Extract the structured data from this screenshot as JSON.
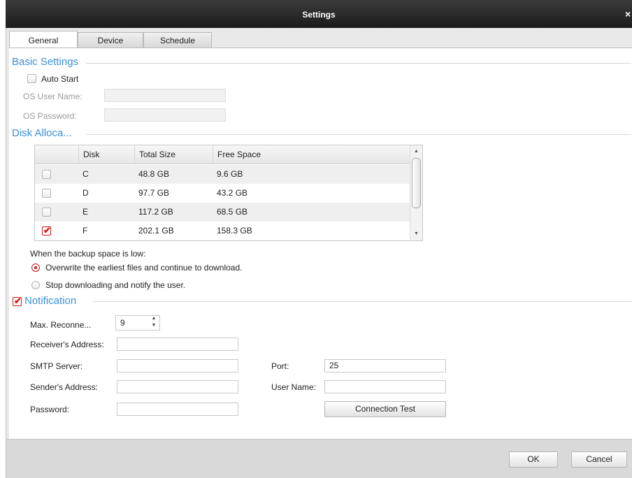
{
  "window": {
    "title": "Settings",
    "close_glyph": "×"
  },
  "tabs": [
    {
      "label": "General",
      "active": true
    },
    {
      "label": "Device",
      "active": false
    },
    {
      "label": "Schedule",
      "active": false
    }
  ],
  "basic_settings": {
    "heading": "Basic Settings",
    "auto_start_label": "Auto Start",
    "auto_start_checked": false,
    "os_user_name_label": "OS User Name:",
    "os_user_name_value": "",
    "os_password_label": "OS Password:",
    "os_password_value": ""
  },
  "disk_allocation": {
    "heading": "Disk Alloca...",
    "columns": [
      "",
      "Disk",
      "Total Size",
      "Free Space"
    ],
    "rows": [
      {
        "checked": false,
        "disk": "C",
        "total": "48.8 GB",
        "free": "9.6 GB"
      },
      {
        "checked": false,
        "disk": "D",
        "total": "97.7 GB",
        "free": "43.2 GB"
      },
      {
        "checked": false,
        "disk": "E",
        "total": "117.2 GB",
        "free": "68.5 GB"
      },
      {
        "checked": true,
        "disk": "F",
        "total": "202.1 GB",
        "free": "158.3 GB"
      }
    ],
    "low_space_label": "When the backup space is low:",
    "options": [
      {
        "label": "Overwrite the earliest files and continue to download.",
        "selected": true
      },
      {
        "label": "Stop downloading and notify the user.",
        "selected": false
      }
    ]
  },
  "notification": {
    "heading": "Notification",
    "enabled": true,
    "max_reconnect_label": "Max. Reconne...",
    "max_reconnect_value": "9",
    "receiver_label": "Receiver's Address:",
    "receiver_value": "",
    "smtp_label": "SMTP Server:",
    "smtp_value": "",
    "port_label": "Port:",
    "port_value": "25",
    "sender_label": "Sender's Address:",
    "sender_value": "",
    "user_name_label": "User Name:",
    "user_name_value": "",
    "password_label": "Password:",
    "password_value": "",
    "connection_test_label": "Connection Test"
  },
  "footer": {
    "ok_label": "OK",
    "cancel_label": "Cancel"
  },
  "colors": {
    "accent": "#3b8fd9",
    "check": "#d41a1a",
    "title_bar": "#2a2a2a"
  }
}
